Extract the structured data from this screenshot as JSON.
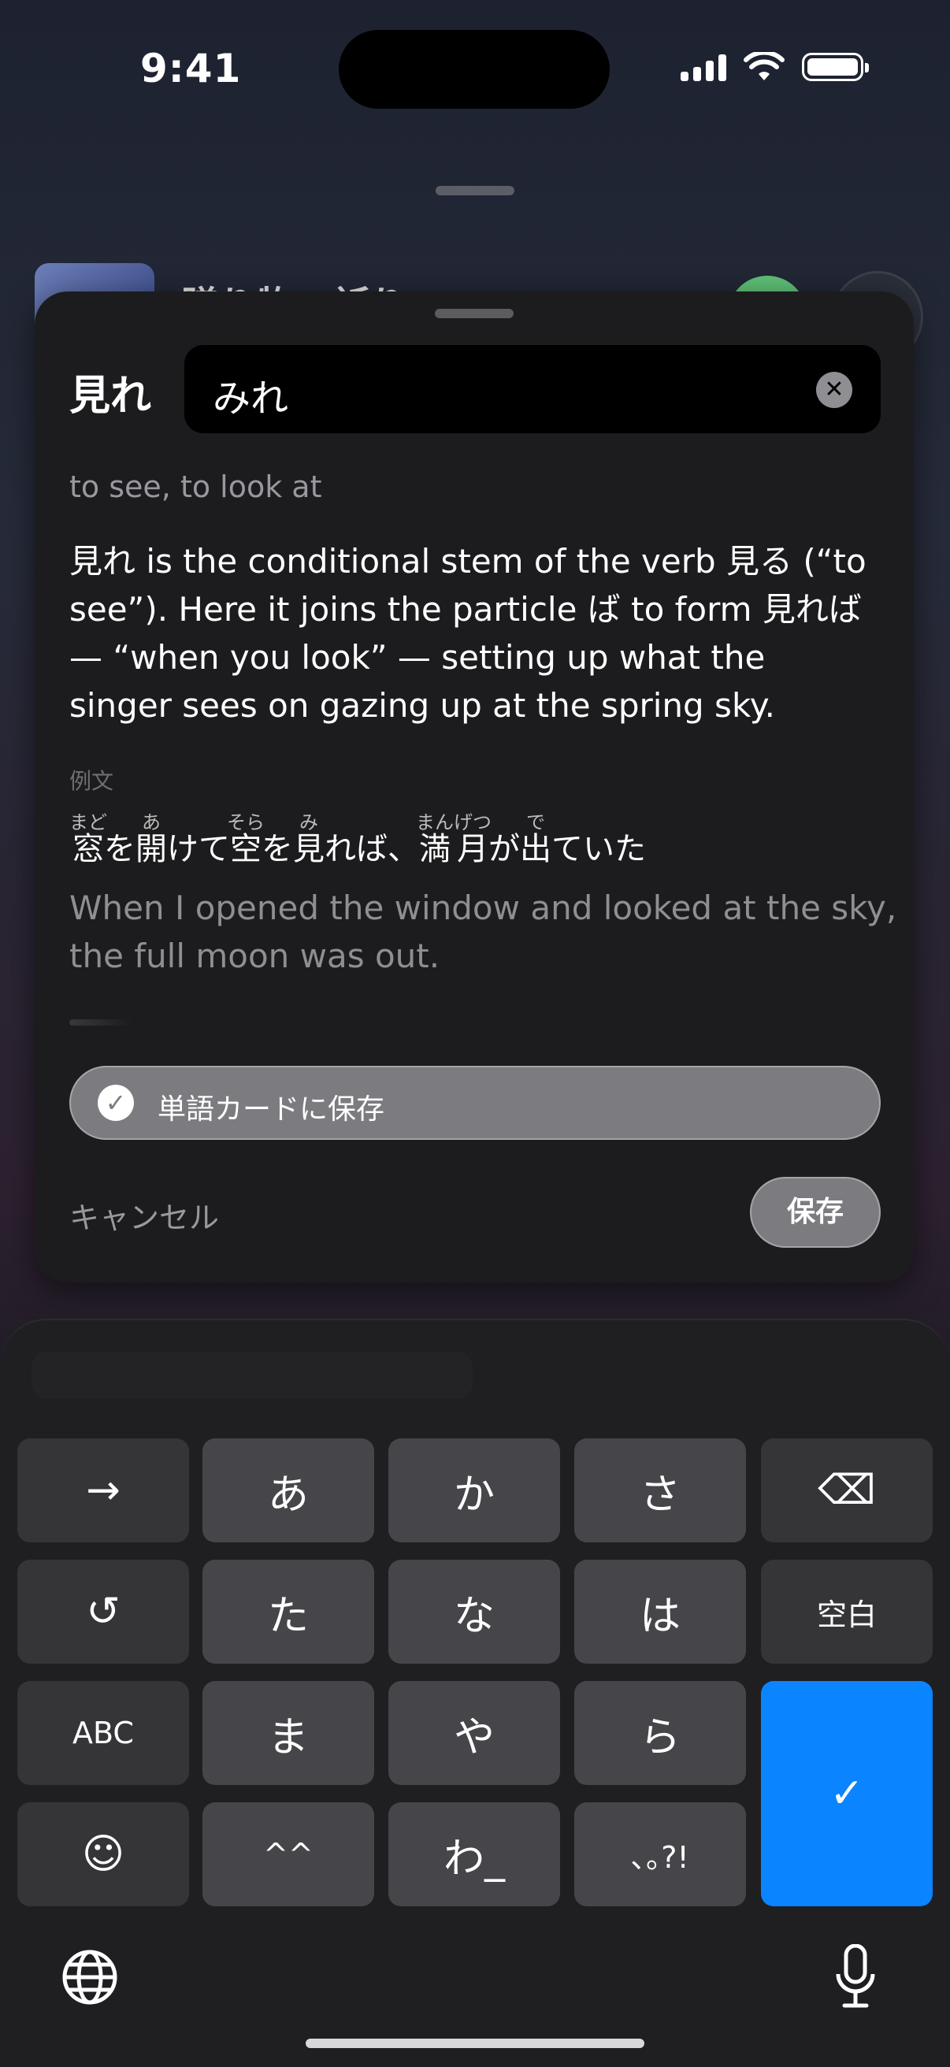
{
  "status_bar": {
    "time": "9:41"
  },
  "background": {
    "title": "贈り物・祈り"
  },
  "sheet": {
    "term": "見れ",
    "reading_value": "みれ",
    "gloss": "to see, to look at",
    "explanation": "見れ is the conditional stem of the verb 見る (“to see”). Here it joins the particle ば to form 見れば — “when you look” — setting up what the singer sees on gazing up at the spring sky.",
    "examples_label": "例文",
    "example": {
      "segments": [
        {
          "base": "窓",
          "ruby": "まど"
        },
        {
          "text": "を"
        },
        {
          "base": "開",
          "ruby": "あ"
        },
        {
          "text": "けて"
        },
        {
          "base": "空",
          "ruby": "そら"
        },
        {
          "text": "を"
        },
        {
          "base": "見",
          "ruby": "み"
        },
        {
          "text": "れば、"
        },
        {
          "base": "満月",
          "ruby": "まんげつ"
        },
        {
          "text": "が"
        },
        {
          "base": "出",
          "ruby": "で"
        },
        {
          "text": "ていた"
        }
      ],
      "translation": "When I opened the window and looked at the sky, the full moon was out."
    },
    "save_to_cards_label": "単語カードに保存",
    "cancel_label": "キャンセル",
    "save_label": "保存"
  },
  "keyboard": {
    "row1": [
      "→",
      "あ",
      "か",
      "さ",
      "⌫"
    ],
    "row2": [
      "↺",
      "た",
      "な",
      "は",
      "空白"
    ],
    "row3": [
      "ABC",
      "ま",
      "や",
      "ら"
    ],
    "row4": [
      "☺",
      "^^",
      "わ_",
      "､｡?!"
    ],
    "return_key": "✓",
    "accent_color": "#0a84ff"
  }
}
